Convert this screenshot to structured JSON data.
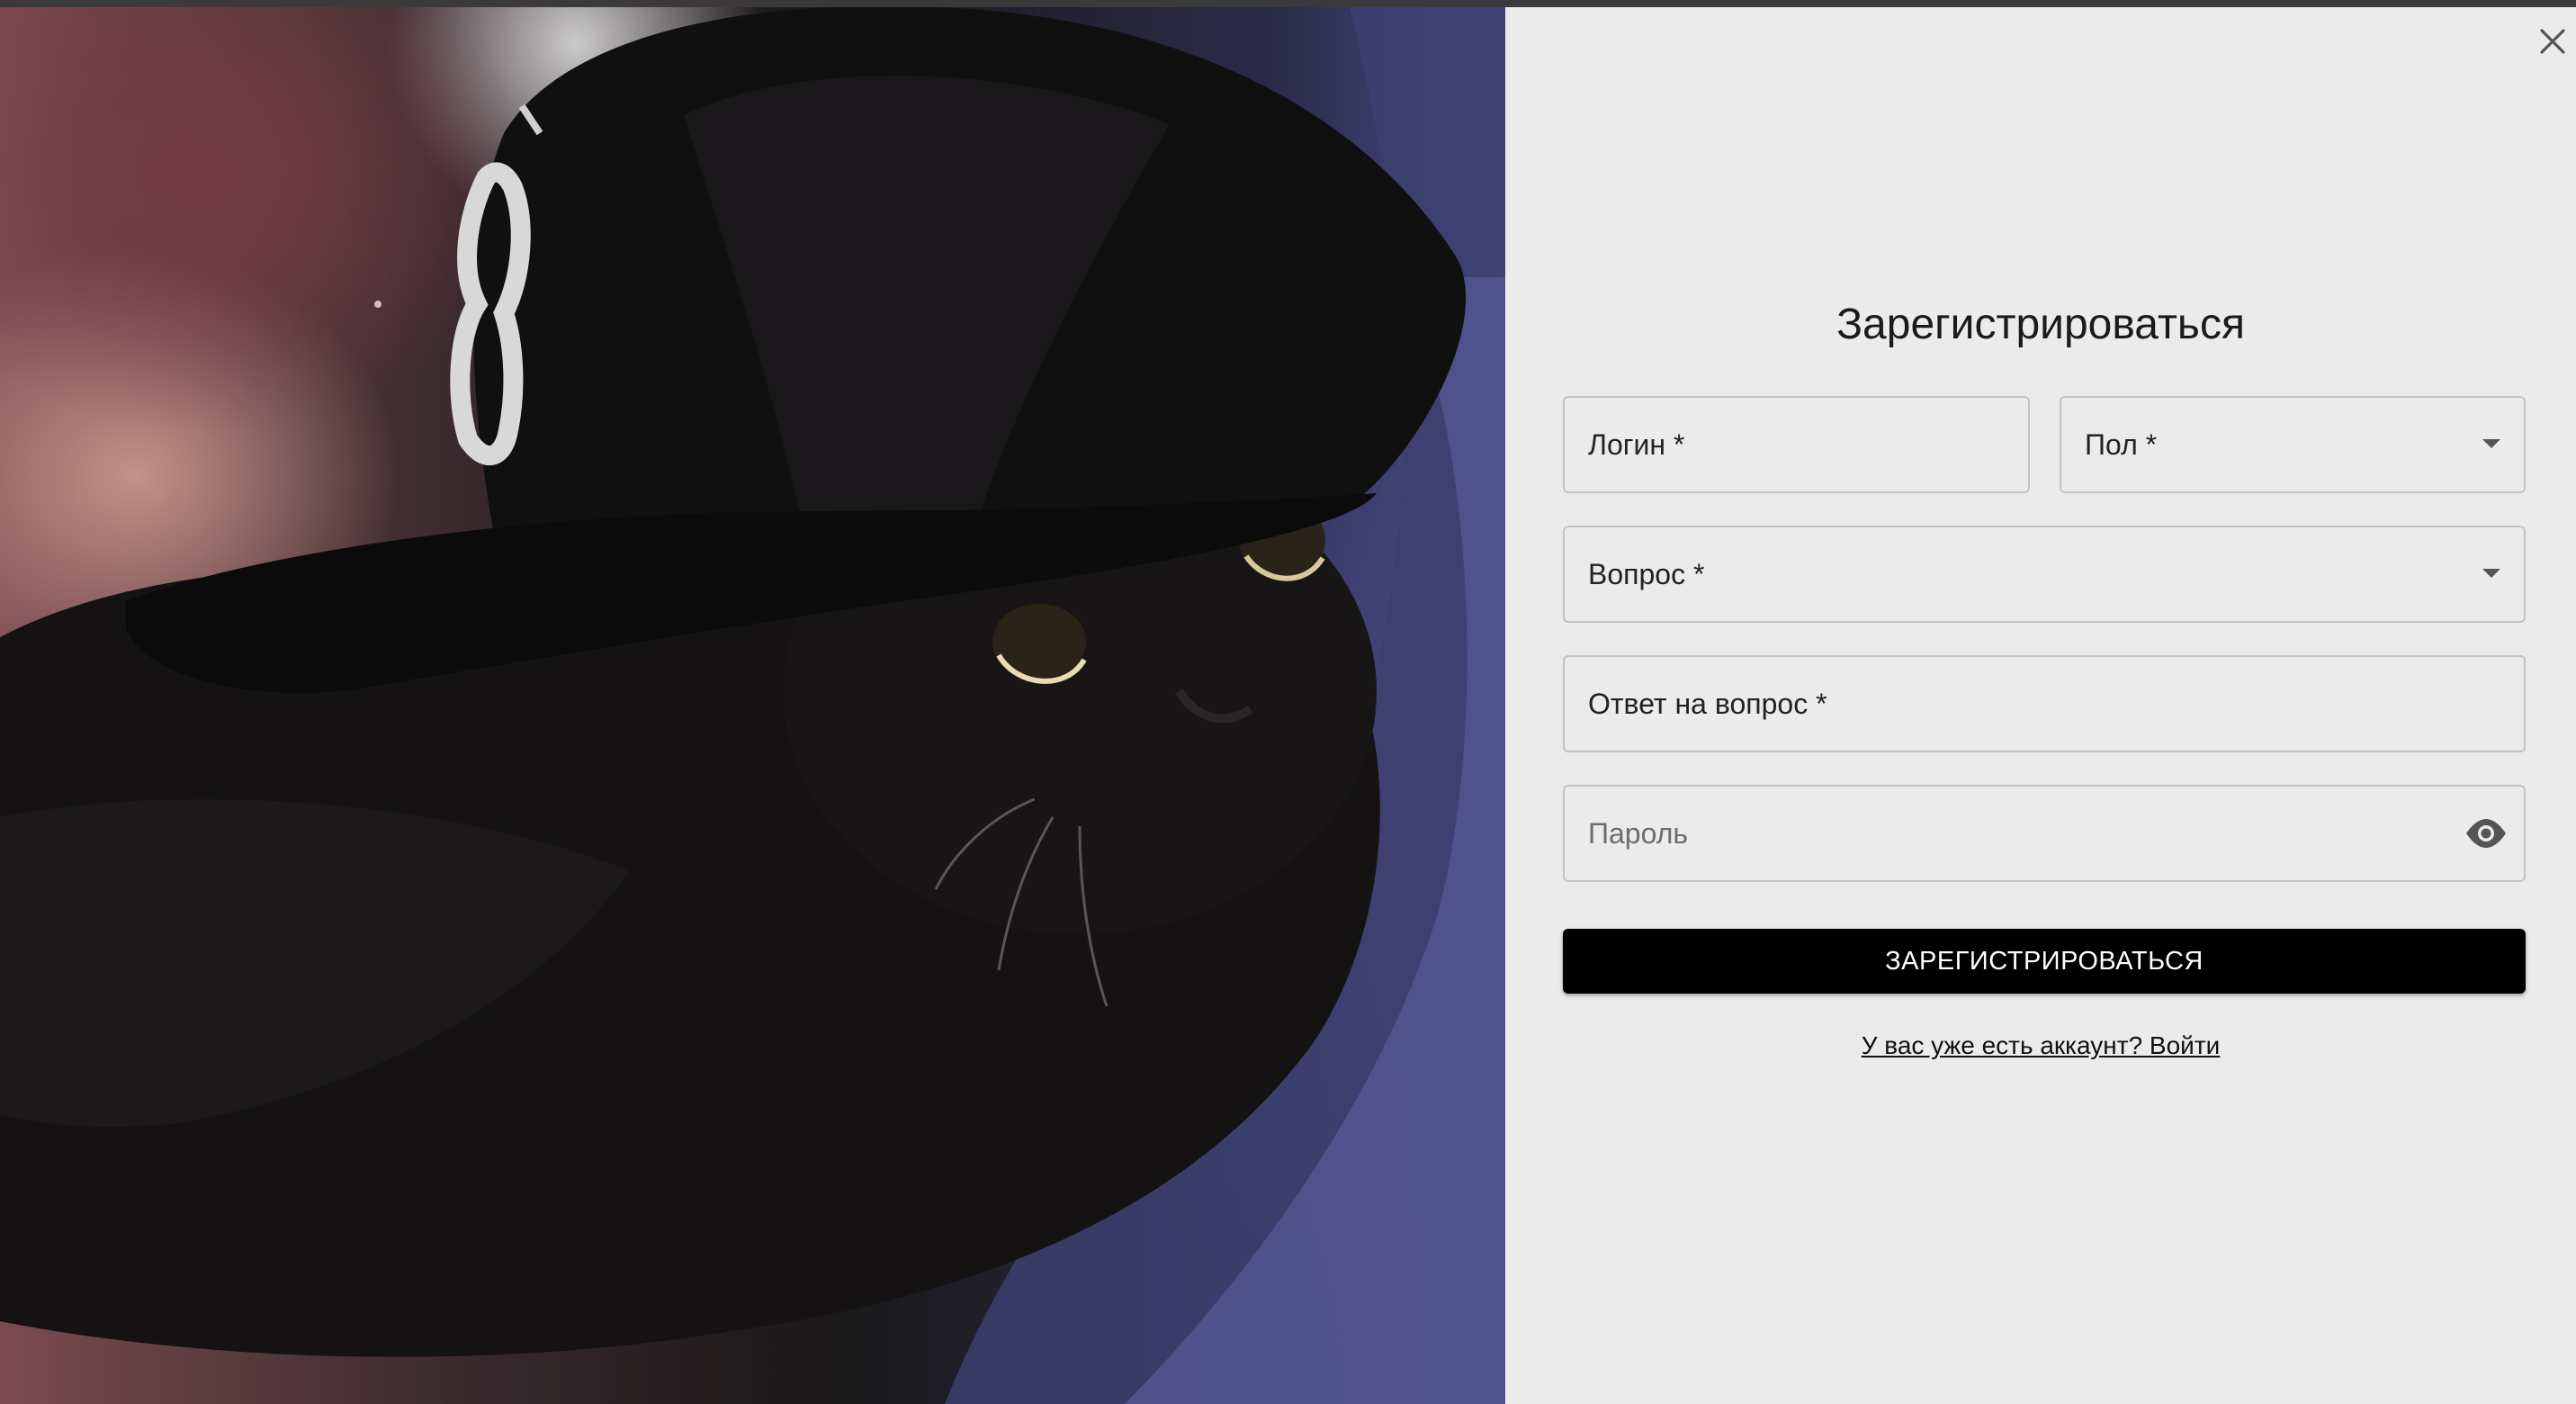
{
  "image": {
    "icon": "photo-black-cat-in-cap"
  },
  "modal": {
    "close_icon": "close-icon",
    "title": "Зарегистрироваться",
    "fields": {
      "login": {
        "label": "Логин *"
      },
      "gender": {
        "label": "Пол *",
        "icon": "chevron-down-icon"
      },
      "question": {
        "label": "Вопрос *",
        "icon": "chevron-down-icon"
      },
      "answer": {
        "label": "Ответ на вопрос *"
      },
      "password": {
        "placeholder": "Пароль",
        "icon": "eye-icon"
      }
    },
    "submit_label": "ЗАРЕГИСТРИРОВАТЬСЯ",
    "login_link": "У вас уже есть аккаунт? Войти"
  },
  "colors": {
    "panel_bg": "#ebebeb",
    "button_bg": "#000000",
    "button_text": "#ffffff",
    "border": "#c3c3c3"
  }
}
